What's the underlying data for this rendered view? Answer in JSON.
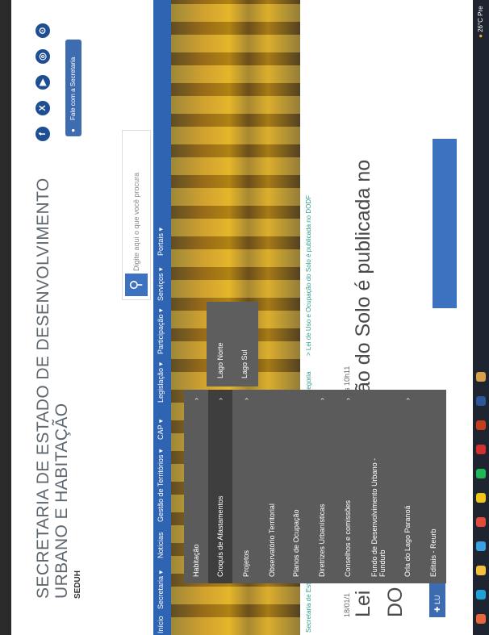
{
  "header": {
    "title_line1": "SECRETARIA DE ESTADO DE DESENVOLVIMENTO",
    "title_line2": "URBANO E HABITAÇÃO",
    "subtitle": "SEDUH",
    "social": [
      "f",
      "X",
      "▶",
      "◎",
      "⊙"
    ],
    "contact_button": "Fale com a Secretaria",
    "search_placeholder": "Digite aqui o que você procura"
  },
  "nav": {
    "items": [
      "Início",
      "Secretaria ▾",
      "Notícias",
      "Gestão de Territórios ▾",
      "CAP ▾",
      "Legislação ▾",
      "Participação ▾",
      "Serviços ▾",
      "Portais ▾"
    ]
  },
  "dropdown": {
    "items": [
      {
        "label": "Habitação",
        "chevron": "›"
      },
      {
        "label": "Croquis de Afastamentos",
        "chevron": "›"
      },
      {
        "label": "Projetos",
        "chevron": "›"
      },
      {
        "label": "Observatório Territorial",
        "chevron": ""
      },
      {
        "label": "Planos de Ocupação",
        "chevron": ""
      },
      {
        "label": "Diretrizes Urbanísticas",
        "chevron": "›"
      },
      {
        "label": "Conselhos e comissões",
        "chevron": "›"
      },
      {
        "label": "Fundo de Desenvolvimento Urbano - Fundurb",
        "chevron": ""
      },
      {
        "label": "Orla do Lago Paranoá",
        "chevron": "›"
      },
      {
        "label": "Editais - Reurb",
        "chevron": ""
      }
    ],
    "submenu": [
      "Lago Norte",
      "Lago Sul"
    ]
  },
  "breadcrumb": {
    "home": "Secretaria de Estado de Desenvolvime",
    "category": "tegoria",
    "current": "Lei de Uso e Ocupação do Solo é publicada no DODF"
  },
  "article": {
    "date": "18/01/1",
    "time": "s 10h11",
    "headline_line1_a": "Lei",
    "headline_line1_b": "ão do Solo é publicada no",
    "headline_line2": "DO",
    "button": "LU"
  },
  "taskbar": {
    "weather": "26°C",
    "weather_extra": "Pre"
  },
  "colors": {
    "nav": "#2f64b3",
    "dropdown": "#5b5b5b",
    "accent": "#3c72c0"
  }
}
